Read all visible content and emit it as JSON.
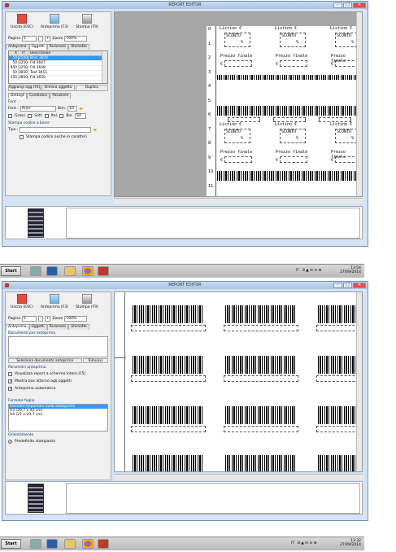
{
  "top_window": {
    "title": "REPORT EDITOR",
    "toolbar": {
      "exit_label": "Uscita (ESC)",
      "preview_label": "Anteprima (F3)",
      "print_label": "Stampa (F9)"
    },
    "pagina_label": "Pagina",
    "pagina_value": "1",
    "zoom_label": "Zoom",
    "zoom_value": "100%",
    "tabs": [
      "Anteprima",
      "Oggetti",
      "Parametri",
      "Etichette"
    ],
    "grid_headers": [
      "X",
      "Tf",
      "Descrizione"
    ],
    "grid_rows": [
      {
        "x": "50",
        "tf": "2500",
        "desc": "Barc 3674",
        "selected": true
      },
      {
        "x": "50",
        "tf": "3250",
        "desc": "Fld 3647",
        "selected": false
      },
      {
        "x": "850",
        "tf": "3250",
        "desc": "Fld 3648",
        "selected": false
      },
      {
        "x": "50",
        "tf": "3850",
        "desc": "Text 3651",
        "selected": false
      },
      {
        "x": "350",
        "tf": "3850",
        "desc": "Fld 3650",
        "selected": false
      }
    ],
    "buttons": [
      "Aggiungi ogg.(F4)",
      "Elimina oggetto",
      "Duplica"
    ],
    "subtabs": [
      "Dettagli",
      "Condizioni",
      "Posizione"
    ],
    "font_group": "Font",
    "font_label": "Font :",
    "font_value": "Arial",
    "dim_label": "Dim.",
    "dim_value": "10",
    "style_checks": [
      "Grass.",
      "Sott.",
      "Ital.",
      "Bor."
    ],
    "sx_value": "SX",
    "barcode_group": "Stampa codice a barre",
    "tipo_label": "Tipo :",
    "barcode_check": "Stampa codice anche in caratteri",
    "label_texts": {
      "listino": "Listino €",
      "sconto": "SCONTO",
      "percent": "%",
      "prezzo": "Prezzo finale",
      "euro": "€"
    },
    "ruler_numbers": [
      "0",
      "1",
      "2",
      "3",
      "4",
      "5",
      "6",
      "7",
      "8",
      "9",
      "10",
      "11"
    ]
  },
  "bottom_window": {
    "title": "REPORT EDITOR",
    "tabs": [
      "Anteprima",
      "Oggetti",
      "Parametri",
      "Etichette"
    ],
    "docs_label": "Documenti per anteprima",
    "select_doc_btn": "Seleziona documento anteprima",
    "remove_btn": "Rimuovi",
    "params_label": "Parametri anteprima",
    "checks": [
      {
        "label": "Visualizza report a schermo intero (F5)",
        "checked": false
      },
      {
        "label": "Mostra box attorno agli oggetti",
        "checked": true
      },
      {
        "label": "Anteprima automatica",
        "checked": true
      }
    ],
    "format_label": "Formato foglio",
    "formats": [
      {
        "label": "Formato impostato sulla stampante",
        "selected": true
      },
      {
        "label": "A3 (29,7 x 42 cm)",
        "selected": false
      },
      {
        "label": "A4 (21 x 29,7 cm)",
        "selected": false
      }
    ],
    "orient_label": "Orientamento",
    "orient_value": "Predefinito stampante"
  },
  "taskbar_top": {
    "start": "Start",
    "lang": "IT",
    "time": "13:54",
    "date": "27/09/2014"
  },
  "taskbar_bottom": {
    "start": "Start",
    "lang": "IT",
    "time": "13:32",
    "date": "27/09/2014"
  },
  "tray_symbols": "8 ▲ ✉ ⊙ ⊗"
}
